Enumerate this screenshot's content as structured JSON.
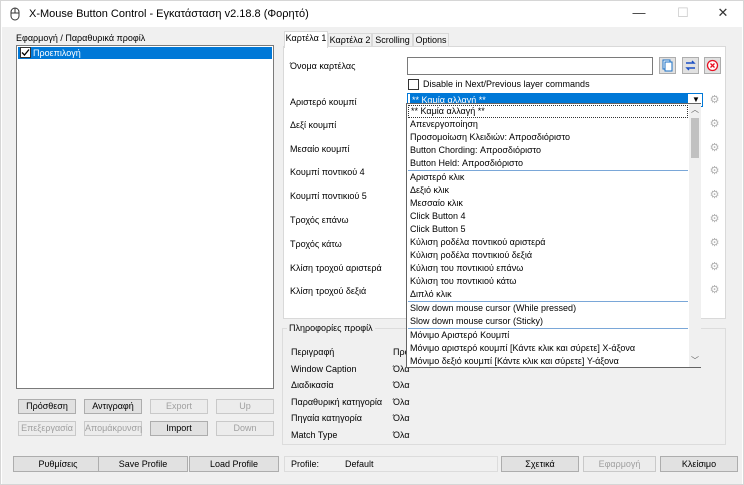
{
  "window": {
    "title": "X-Mouse Button Control - Εγκατάσταση v2.18.8 (Φορητό)"
  },
  "profiles_panel": {
    "header": "Εφαρμογή / Παραθυρικά προφίλ",
    "items": [
      {
        "label": "Προεπιλογή",
        "checked": true
      }
    ],
    "buttons": {
      "add": "Πρόσθεση",
      "copy": "Αντιγραφή",
      "export": "Export",
      "up": "Up",
      "edit": "Επεξεργασία",
      "remove": "Απομάκρυνση",
      "import": "Import",
      "down": "Down"
    }
  },
  "tabs": [
    {
      "label": "Καρτέλα 1",
      "active": true
    },
    {
      "label": "Καρτέλα 2",
      "active": false
    },
    {
      "label": "Scrolling",
      "active": false
    },
    {
      "label": "Options",
      "active": false
    }
  ],
  "tab1": {
    "tab_name_label": "Όνομα καρτέλας",
    "tab_name_value": "",
    "disable_layer_label": "Disable in Next/Previous layer commands",
    "rows": [
      {
        "label": "Αριστερό κουμπί"
      },
      {
        "label": "Δεξί κουμπί"
      },
      {
        "label": "Μεσαίο κουμπί"
      },
      {
        "label": "Κουμπί ποντικού 4"
      },
      {
        "label": "Κουμπί ποντικιού 5"
      },
      {
        "label": "Τροχός επάνω"
      },
      {
        "label": "Τροχός κάτω"
      },
      {
        "label": "Κλίση τροχού αριστερά"
      },
      {
        "label": "Κλίση τροχού δεξιά"
      }
    ],
    "left_button_value": "** Καμία αλλαγή **"
  },
  "dropdown": {
    "items": [
      "** Καμία αλλαγή **",
      "Απενεργοποίηση",
      "Προσομοίωση Κλειδιών: Απροσδιόριστο",
      "Button Chording: Απροσδιόριστο",
      "Button Held: Απροσδιόριστο",
      "Αριστερό κλικ",
      "Δεξιό κλικ",
      "Μεσσαίο κλικ",
      "Click Button 4",
      "Click Button 5",
      "Κύλιση ροδέλα ποντικού αριστερά",
      "Κύλιση ροδέλα ποντικιού δεξιά",
      "Κύλιση του ποντικιού επάνω",
      "Κύλιση του ποντικιού κάτω",
      "Διπλό κλικ",
      "Slow down mouse cursor (While pressed)",
      "Slow down mouse cursor (Sticky)",
      "Μόνιμο Αριστερό Κουμπί",
      "Μόνιμο αριστερό κουμπί [Κάντε κλικ και σύρετε] Χ-άξονα",
      "Μόνιμο δεξιό κουμπί [Κάντε κλικ και σύρετε] Y-άξονα"
    ]
  },
  "profile_info": {
    "header": "Πληροφορίες προφίλ",
    "rows": [
      {
        "label": "Περιγραφή",
        "value": "Προε"
      },
      {
        "label": "Window Caption",
        "value": "Όλα"
      },
      {
        "label": "Διαδικασία",
        "value": "Όλα"
      },
      {
        "label": "Παραθυρική κατηγορία",
        "value": "Όλα"
      },
      {
        "label": "Πηγαία κατηγορία",
        "value": "Όλα"
      },
      {
        "label": "Match Type",
        "value": "Όλα"
      }
    ]
  },
  "bottom_bar": {
    "settings": "Ρυθμίσεις",
    "save_profile": "Save Profile",
    "load_profile": "Load Profile",
    "profile_label": "Profile:",
    "profile_value": "Default",
    "about": "Σχετικά",
    "apply": "Εφαρμογή",
    "close": "Κλείσιμο"
  },
  "colors": {
    "selection": "#0078d7",
    "background": "#f0f0f0",
    "close_icon": "#e81123"
  }
}
